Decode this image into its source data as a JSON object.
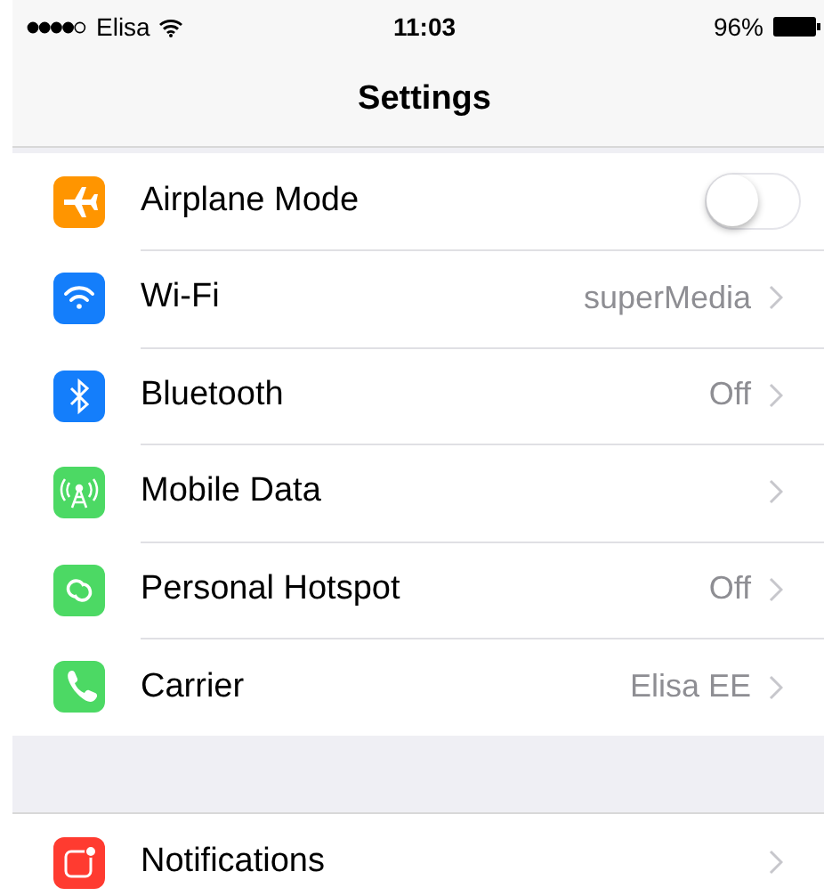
{
  "status_bar": {
    "carrier": "Elisa",
    "time": "11:03",
    "battery": "96%"
  },
  "nav": {
    "title": "Settings"
  },
  "groups": [
    {
      "rows": [
        {
          "kind": "toggle",
          "label": "Airplane Mode",
          "color": "#ff9500",
          "on": false
        },
        {
          "kind": "link",
          "label": "Wi-Fi",
          "color": "#147efb",
          "value": "superMedia"
        },
        {
          "kind": "link",
          "label": "Bluetooth",
          "color": "#147efb",
          "value": "Off"
        },
        {
          "kind": "link",
          "label": "Mobile Data",
          "color": "#4cd964"
        },
        {
          "kind": "link",
          "label": "Personal Hotspot",
          "color": "#4cd964",
          "value": "Off"
        },
        {
          "kind": "link",
          "label": "Carrier",
          "color": "#4cd964",
          "value": "Elisa EE"
        }
      ]
    },
    {
      "rows": [
        {
          "kind": "link",
          "label": "Notifications",
          "color": "#ff3b30"
        }
      ]
    }
  ]
}
